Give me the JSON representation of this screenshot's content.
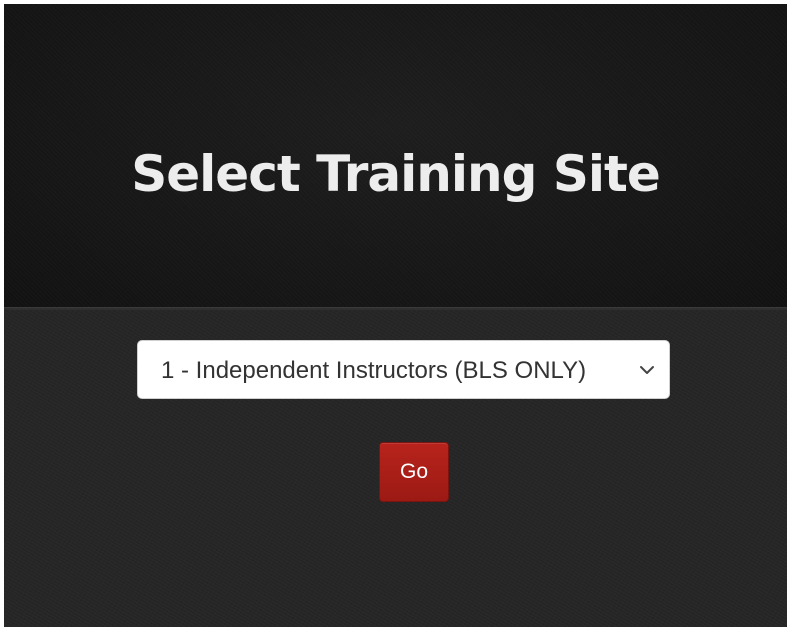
{
  "page": {
    "title": "Select Training Site"
  },
  "site_select": {
    "selected_value": "1 - Independent Instructors (BLS ONLY)",
    "icon": "chevron-down-icon"
  },
  "go_button": {
    "label": "Go",
    "color": "#a71e17"
  },
  "colors": {
    "header_background": "#161616",
    "body_background": "#262626",
    "title_text": "#ededed"
  }
}
